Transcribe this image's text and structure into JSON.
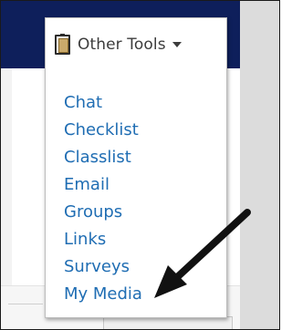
{
  "dropdown": {
    "label": "Other Tools",
    "icon": "clipboard-icon",
    "caret_icon": "caret-down-icon",
    "items": [
      {
        "label": "Chat"
      },
      {
        "label": "Checklist"
      },
      {
        "label": "Classlist"
      },
      {
        "label": "Email"
      },
      {
        "label": "Groups"
      },
      {
        "label": "Links"
      },
      {
        "label": "Surveys"
      },
      {
        "label": "My Media"
      }
    ]
  },
  "colors": {
    "navbar": "#0e1f5b",
    "link": "#1f6db3",
    "arrow": "#111111"
  },
  "annotation": {
    "icon": "black-arrow-pointer",
    "points_to": "My Media"
  }
}
